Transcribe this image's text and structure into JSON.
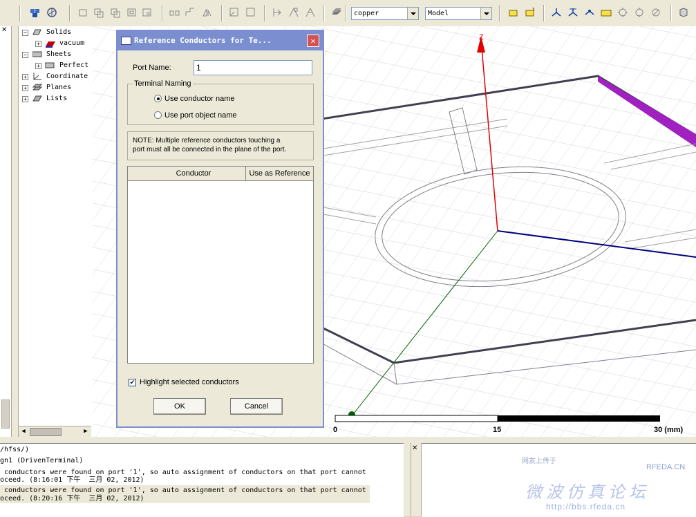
{
  "toolbar": {
    "material_combo": "copper",
    "model_combo": "Model"
  },
  "tree": {
    "items": [
      {
        "label": "Solids"
      },
      {
        "label": "vacuum"
      },
      {
        "label": "Sheets"
      },
      {
        "label": "Perfect"
      },
      {
        "label": "Coordinate"
      },
      {
        "label": "Planes"
      },
      {
        "label": "Lists"
      }
    ]
  },
  "viewport": {
    "axis_z_label": "Z",
    "scale": {
      "tick0": "0",
      "tick1": "15",
      "tick2": "30 (mm)"
    }
  },
  "dialog": {
    "title": "Reference Conductors for Te...",
    "port_name_label": "Port Name:",
    "port_name_value": "1",
    "terminal_naming_label": "Terminal Naming",
    "radio_conductor": "Use conductor name",
    "radio_port_object": "Use port object name",
    "note_line1": "NOTE: Multiple reference conductors touching a",
    "note_line2": "port must all be connected in the plane of the port.",
    "table_headers": [
      "Conductor",
      "Use as Reference"
    ],
    "highlight_label": "Highlight selected conductors",
    "ok_label": "OK",
    "cancel_label": "Cancel"
  },
  "console": {
    "lines": [
      "/hfss/)",
      "gn1 (DrivenTerminal)",
      " conductors were found on port '1', so auto assignment of conductors on that port cannot",
      "oceed. (8:16:01 下午  三月 02, 2012)",
      " conductors were found on port '1', so auto assignment of conductors on that port cannot",
      "oceed. (8:20:16 下午  三月 02, 2012)"
    ]
  },
  "watermark": {
    "site": "RFEDA.CN",
    "chinese": "微波仿真论坛",
    "url": "http://bbs.rfeda.cn",
    "small": "网友上传于"
  },
  "colors": {
    "dialog_title": "#7b8fd0",
    "axis_z": "#e00000",
    "axis_x": "#000080",
    "axis_y": "#006000",
    "port_sheet": "#a020c0"
  },
  "icons": [
    "hfss-icon",
    "rotate-icon",
    "box-icon",
    "cylinder-icon",
    "polygon-icon",
    "wire-icon",
    "mesh-icon",
    "split-icon",
    "stack-icon",
    "measure-icon",
    "plane-icon",
    "coordinate-icon",
    "solve-icon"
  ]
}
